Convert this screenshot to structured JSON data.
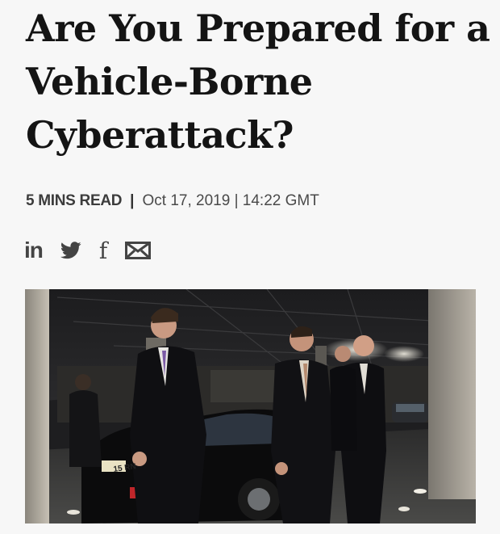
{
  "article": {
    "title": "Are You Prepared for a Vehicle-Borne Cyberattack?",
    "read_time": "5 MINS READ",
    "separator": "|",
    "datetime": "Oct 17, 2019 | 14:22 GMT"
  },
  "share": {
    "icons": [
      "linkedin-icon",
      "twitter-icon",
      "facebook-icon",
      "email-icon"
    ],
    "linkedin_label": "in",
    "facebook_label": "f",
    "icon_color": "#444444"
  },
  "photo": {
    "plate_text": "15 RN"
  }
}
